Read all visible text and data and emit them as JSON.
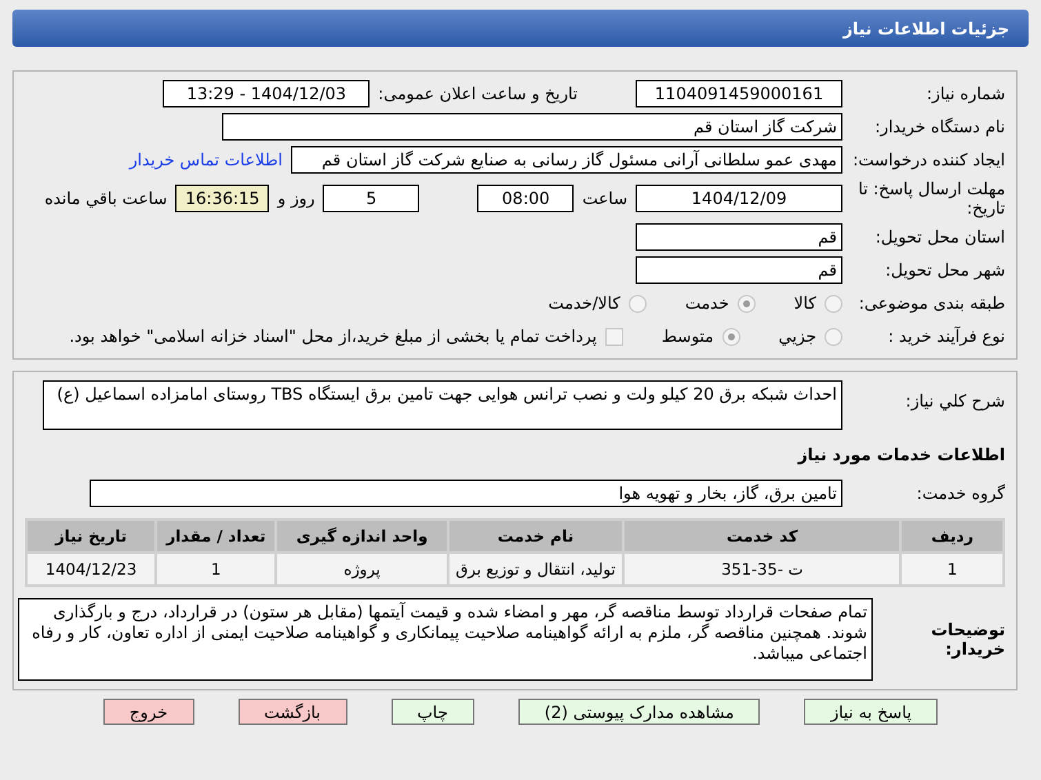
{
  "window": {
    "title": "جزئیات اطلاعات نیاز"
  },
  "details": {
    "need_number": {
      "label": "شماره نیاز:",
      "value": "1104091459000161"
    },
    "announce": {
      "label": "تاریخ و ساعت اعلان عمومی:",
      "value": "1404/12/03 - 13:29"
    },
    "buyer": {
      "label": "نام دستگاه خریدار:",
      "value": "شرکت گاز استان قم"
    },
    "creator": {
      "label": "ایجاد کننده درخواست:",
      "value": "مهدی عمو سلطانی آرانی مسئول گاز رسانی به صنایع شرکت گاز استان قم",
      "link": "اطلاعات تماس خریدار"
    },
    "deadline": {
      "label": "مهلت ارسال پاسخ: تا تاریخ:",
      "date": "1404/12/09",
      "time_label": "ساعت",
      "time": "08:00",
      "days": "5",
      "days_label": "روز و",
      "remaining": "16:36:15",
      "remaining_label": "ساعت باقي مانده"
    },
    "province": {
      "label": "استان محل تحویل:",
      "value": "قم"
    },
    "city": {
      "label": "شهر محل تحویل:",
      "value": "قم"
    },
    "category": {
      "label": "طبقه بندی موضوعی:",
      "options": [
        {
          "label": "کالا",
          "selected": false
        },
        {
          "label": "خدمت",
          "selected": true
        },
        {
          "label": "کالا/خدمت",
          "selected": false
        }
      ]
    },
    "process": {
      "label": "نوع فرآیند خرید :",
      "options": [
        {
          "label": "جزيي",
          "selected": false
        },
        {
          "label": "متوسط",
          "selected": true
        }
      ],
      "payment": {
        "checked": false,
        "text": "پرداخت تمام یا بخشی از مبلغ خرید،از محل \"اسناد خزانه اسلامی\" خواهد بود."
      }
    }
  },
  "summary": {
    "label": "شرح کلي نیاز:",
    "value": "احداث شبکه برق 20 کیلو ولت و نصب ترانس هوایی جهت تامین برق ایستگاه TBS روستای امامزاده اسماعیل (ع)"
  },
  "services": {
    "title": "اطلاعات خدمات مورد نیاز",
    "group_label": "گروه خدمت:",
    "group": "تامین برق، گاز، بخار و تهویه هوا",
    "table": {
      "columns": [
        "ردیف",
        "کد خدمت",
        "نام خدمت",
        "واحد اندازه گیری",
        "تعداد / مقدار",
        "تاریخ نیاز"
      ],
      "rows": [
        [
          "1",
          "ت -35-351",
          "تولید، انتقال و توزیع برق",
          "پروژه",
          "1",
          "1404/12/23"
        ]
      ]
    }
  },
  "notes": {
    "label": "توضیحات خریدار:",
    "value": "تمام صفحات قرارداد توسط مناقصه گر، مهر و امضاء شده و قیمت آیتمها (مقابل هر ستون) در قرارداد، درج و بارگذاری شوند. همچنین مناقصه گر، ملزم به ارائه گواهینامه صلاحیت پیمانکاری و گواهینامه صلاحیت ایمنی از اداره تعاون، کار و رفاه اجتماعی میباشد."
  },
  "buttons": [
    {
      "label": "پاسخ به نیاز",
      "kind": "action"
    },
    {
      "label": "مشاهده مدارک پیوستی (2)",
      "kind": "action"
    },
    {
      "label": "چاپ",
      "kind": "action"
    },
    {
      "label": "بازگشت",
      "kind": "exit"
    },
    {
      "label": "خروج",
      "kind": "exit"
    }
  ]
}
